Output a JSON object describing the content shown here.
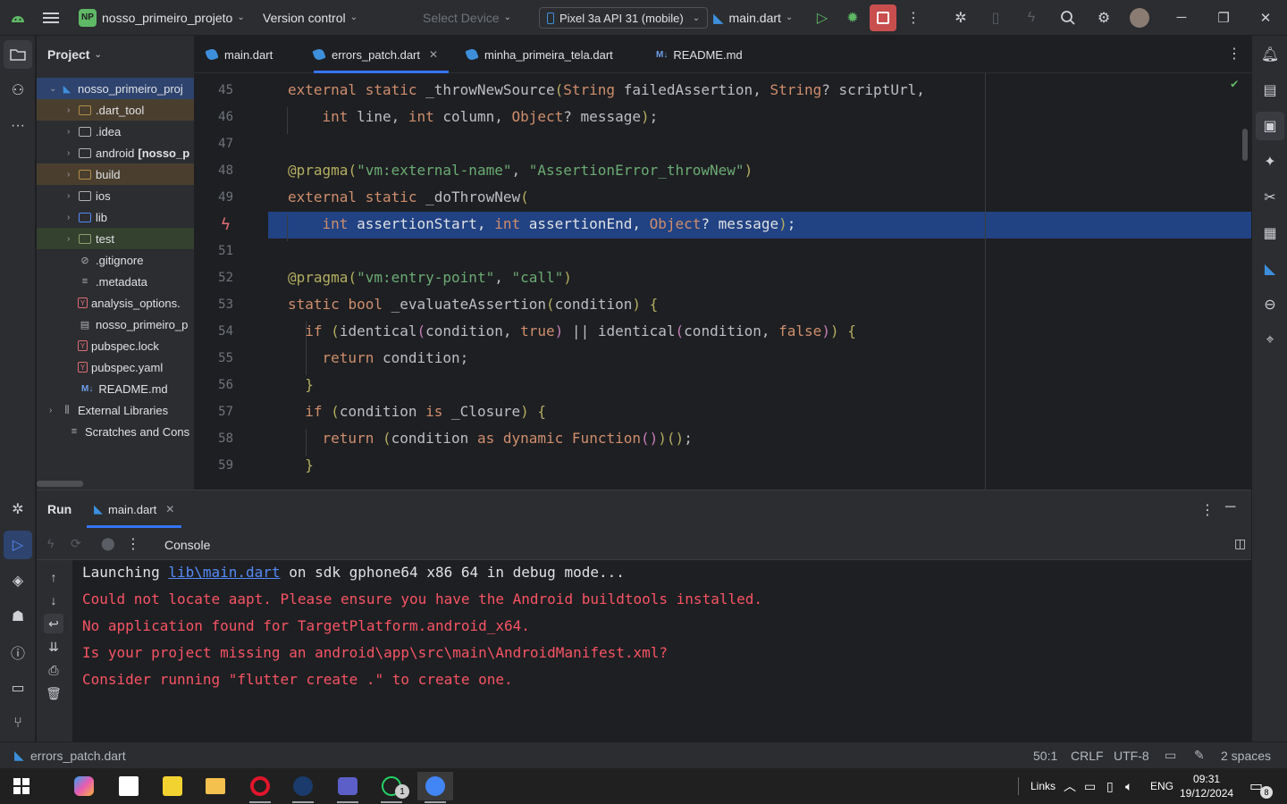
{
  "titlebar": {
    "project_initials": "NP",
    "project_name": "nosso_primeiro_projeto",
    "version_control": "Version control",
    "select_device": "Select Device",
    "device": "Pixel 3a API 31 (mobile)",
    "run_config": "main.dart"
  },
  "project_panel": {
    "title": "Project",
    "items": [
      {
        "label": "nosso_primeiro_projeto",
        "display": "nosso_primeiro_proj"
      },
      {
        "label": ".dart_tool"
      },
      {
        "label": ".idea"
      },
      {
        "label": "android",
        "suffix": "[nosso_p"
      },
      {
        "label": "build"
      },
      {
        "label": "ios"
      },
      {
        "label": "lib"
      },
      {
        "label": "test"
      },
      {
        "label": ".gitignore"
      },
      {
        "label": ".metadata"
      },
      {
        "label": "analysis_options."
      },
      {
        "label": "nosso_primeiro_p"
      },
      {
        "label": "pubspec.lock"
      },
      {
        "label": "pubspec.yaml"
      },
      {
        "label": "README.md"
      },
      {
        "label": "External Libraries"
      },
      {
        "label": "Scratches and Cons"
      }
    ]
  },
  "editor_tabs": [
    {
      "label": "main.dart"
    },
    {
      "label": "errors_patch.dart",
      "active": true
    },
    {
      "label": "minha_primeira_tela.dart"
    },
    {
      "label": "README.md",
      "badge": "M↓"
    }
  ],
  "editor": {
    "line_numbers": [
      "45",
      "46",
      "47",
      "48",
      "49",
      "50",
      "51",
      "52",
      "53",
      "54",
      "55",
      "56",
      "57",
      "58",
      "59"
    ],
    "code": [
      "external static _throwNewSource(String failedAssertion, String? scriptUrl,",
      "    int line, int column, Object? message);",
      "",
      "@pragma(\"vm:external-name\", \"AssertionError_throwNew\")",
      "external static _doThrowNew(",
      "    int assertionStart, int assertionEnd, Object? message);",
      "",
      "@pragma(\"vm:entry-point\", \"call\")",
      "static bool _evaluateAssertion(condition) {",
      "  if (identical(condition, true) || identical(condition, false)) {",
      "    return condition;",
      "  }",
      "  if (condition is _Closure) {",
      "    return (condition as dynamic Function())();",
      "  }"
    ]
  },
  "run_panel": {
    "title": "Run",
    "tab": "main.dart",
    "console_label": "Console",
    "output": {
      "launch_prefix": "Launching ",
      "launch_link": "lib\\main.dart",
      "launch_suffix": " on sdk gphone64 x86 64 in debug mode...",
      "errors": [
        "Could not locate aapt. Please ensure you have the Android buildtools installed.",
        "No application found for TargetPlatform.android_x64.",
        "Is your project missing an android\\app\\src\\main\\AndroidManifest.xml?",
        "Consider running \"flutter create .\" to create one."
      ]
    }
  },
  "statusbar": {
    "file": "errors_patch.dart",
    "position": "50:1",
    "line_sep": "CRLF",
    "encoding": "UTF-8",
    "indent": "2 spaces"
  },
  "taskbar": {
    "links": "Links",
    "lang": "ENG",
    "time": "09:31",
    "date": "19/12/2024",
    "notif_count": "8",
    "whatsapp_count": "1"
  },
  "colors": {
    "accent": "#3574f0",
    "error": "#f75464",
    "selection": "#214283"
  }
}
